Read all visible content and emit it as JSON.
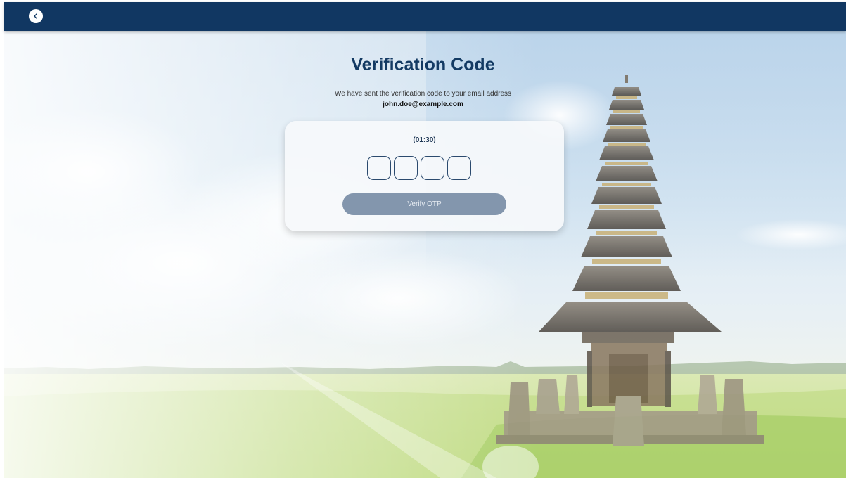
{
  "header": {
    "back_icon": "chevron-left-icon",
    "bar_color": "#113762"
  },
  "main": {
    "title": "Verification Code",
    "subtitle": "We have sent the verification code to your email address",
    "email": "john.doe@example.com"
  },
  "otp_card": {
    "timer": "(01:30)",
    "digits": [
      "",
      "",
      "",
      ""
    ],
    "verify_label": "Verify OTP",
    "button_color": "#8396ad"
  },
  "background": {
    "theme": "temple-rice-field",
    "accent": "#133a63"
  }
}
